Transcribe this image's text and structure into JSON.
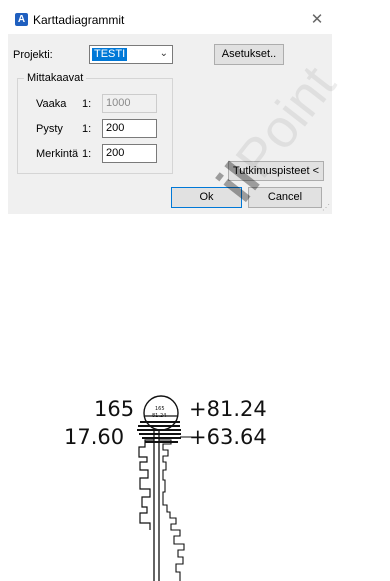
{
  "dialog": {
    "title": "Karttadiagrammit",
    "title_icon": "A",
    "project_label": "Projekti:",
    "project_value": "TESTI",
    "settings_button": "Asetukset..",
    "scale_group_label": "Mittakaavat",
    "rows": [
      {
        "label": "Vaaka",
        "prefix": "1:",
        "value": "1000",
        "disabled": true
      },
      {
        "label": "Pysty",
        "prefix": "1:",
        "value": "200",
        "disabled": false
      },
      {
        "label": "Merkintä",
        "prefix": "1:",
        "value": "200",
        "disabled": false
      }
    ],
    "points_button": "Tutkimuspisteet <",
    "ok_button": "Ok",
    "cancel_button": "Cancel"
  },
  "drawing": {
    "left_top": "165",
    "left_bottom": "17.60",
    "right_top": "+81.24",
    "right_bottom": "+63.64",
    "circle_top": "165",
    "circle_bottom": "81.24"
  },
  "watermark": {
    "brand_bold": "il",
    "brand_rest": "Point"
  }
}
